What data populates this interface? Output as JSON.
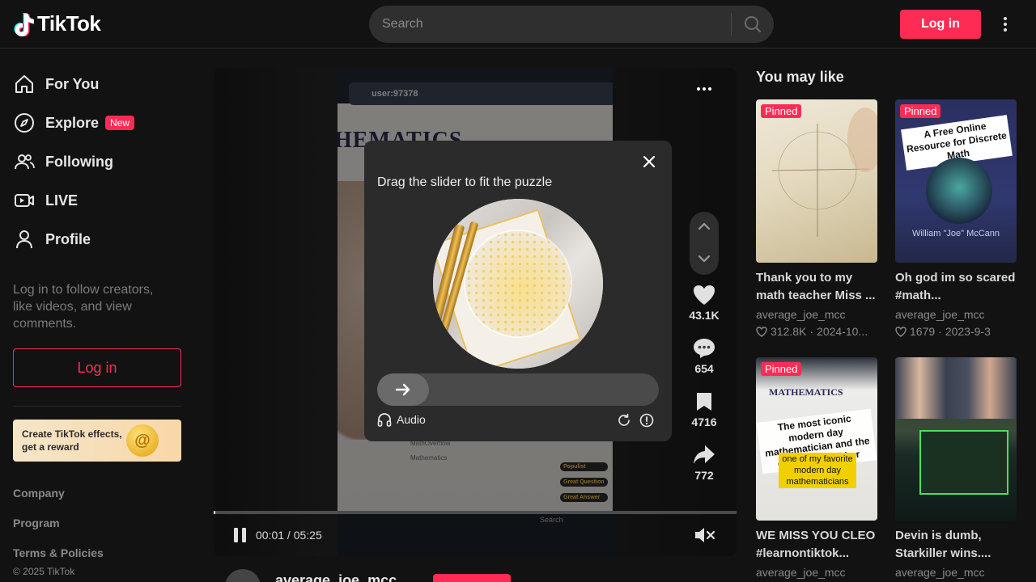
{
  "header": {
    "logo_text": "TikTok",
    "search_placeholder": "Search",
    "login_label": "Log in"
  },
  "sidebar": {
    "items": [
      {
        "label": "For You",
        "icon": "home-icon"
      },
      {
        "label": "Explore",
        "icon": "compass-icon",
        "badge": "New"
      },
      {
        "label": "Following",
        "icon": "people-icon"
      },
      {
        "label": "LIVE",
        "icon": "live-icon"
      },
      {
        "label": "Profile",
        "icon": "person-icon"
      }
    ],
    "hint": "Log in to follow creators, like videos, and view comments.",
    "login_label": "Log in",
    "effects_banner": "Create TikTok effects, get a reward",
    "footer_links": [
      "Company",
      "Program",
      "Terms & Policies"
    ],
    "copyright": "© 2025 TikTok"
  },
  "video": {
    "screen_search": "user:97378",
    "screen_title": "HEMATICS",
    "screen_rows": [
      "MathOverflow",
      "Mathematics"
    ],
    "screen_badges": [
      "Populist",
      "Great Question",
      "Great Answer"
    ],
    "screen_taskbar_search": "Search",
    "likes": "43.1K",
    "comments": "654",
    "saves": "4716",
    "shares": "772",
    "time": "00:01 / 05:25",
    "progress": 0.003,
    "author": "average_joe_mcc"
  },
  "captcha": {
    "title": "Drag the slider to fit the puzzle",
    "audio_label": "Audio"
  },
  "recommendations": {
    "title": "You may like",
    "cards": [
      {
        "pinned": "Pinned",
        "title": "Thank you to my math teacher Miss ...",
        "author": "average_joe_mcc",
        "likes": "312.8K",
        "date": "2024-10..."
      },
      {
        "pinned": "Pinned",
        "title": "Oh god im so scared #math...",
        "author": "average_joe_mcc",
        "likes": "1679",
        "date": "2023-9-3",
        "thumb_text": "A Free Online Resource for Discrete Math",
        "thumb_name": "William \"Joe\" McCann"
      },
      {
        "pinned": "Pinned",
        "title": "WE MISS YOU CLEO #learnontiktok...",
        "author": "average_joe_mcc",
        "thumb_title": "MATHEMATICS",
        "thumb_caption": "The most iconic modern day mathematician and the drama around her",
        "thumb_caption2": "one of my favorite modern day mathematicians"
      },
      {
        "pinned": "",
        "title": "Devin is dumb, Starkiller wins....",
        "author": "average_joe_mcc"
      }
    ]
  },
  "colors": {
    "accent": "#fe2c55",
    "background": "#121212"
  }
}
